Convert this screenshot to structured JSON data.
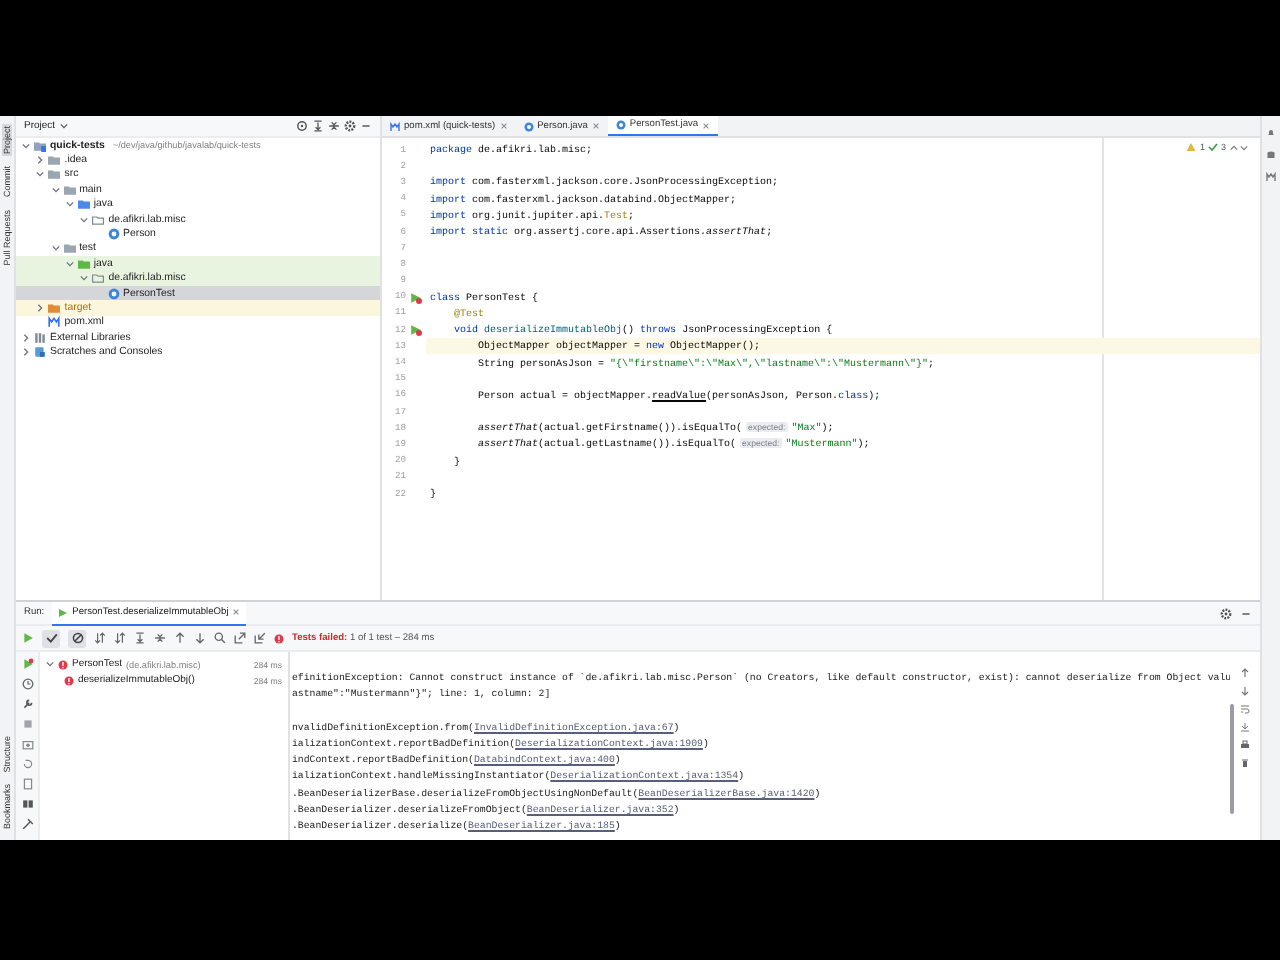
{
  "side_tabs_top": [
    {
      "label": "Project",
      "selected": true
    },
    {
      "label": "Commit",
      "selected": false
    },
    {
      "label": "Pull Requests",
      "selected": false
    }
  ],
  "side_tabs_bottom": [
    {
      "label": "Structure",
      "selected": false
    },
    {
      "label": "Bookmarks",
      "selected": false
    }
  ],
  "project": {
    "title": "Project",
    "tree": [
      {
        "label": "quick-tests",
        "detail": "~/dev/java/github/javalab/quick-tests",
        "kind": "module",
        "expanded": true,
        "selected": false,
        "children": [
          {
            "label": ".idea",
            "kind": "folder",
            "expanded": false,
            "selected": false
          },
          {
            "label": "src",
            "kind": "folder",
            "expanded": true,
            "selected": false,
            "children": [
              {
                "label": "main",
                "kind": "folder",
                "expanded": true,
                "selected": false,
                "children": [
                  {
                    "label": "java",
                    "kind": "source",
                    "expanded": true,
                    "selected": false,
                    "children": [
                      {
                        "label": "de.afikri.lab.misc",
                        "kind": "package",
                        "expanded": true,
                        "selected": false,
                        "children": [
                          {
                            "label": "Person",
                            "kind": "class",
                            "selected": false
                          }
                        ]
                      }
                    ]
                  }
                ]
              },
              {
                "label": "test",
                "kind": "folder",
                "expanded": true,
                "selected": false,
                "children": [
                  {
                    "label": "java",
                    "kind": "test",
                    "color": "#e8f4df",
                    "expanded": true,
                    "selected": false,
                    "children": [
                      {
                        "label": "de.afikri.lab.misc",
                        "kind": "package",
                        "color": "#e8f4df",
                        "expanded": true,
                        "selected": false,
                        "children": [
                          {
                            "label": "PersonTest",
                            "kind": "class",
                            "selected": true
                          }
                        ]
                      }
                    ]
                  }
                ]
              }
            ]
          },
          {
            "label": "target",
            "kind": "excluded",
            "color": "#fbf6dc",
            "expanded": false,
            "selected": false
          },
          {
            "label": "pom.xml",
            "kind": "xml",
            "selected": false
          }
        ]
      },
      {
        "label": "External Libraries",
        "kind": "library",
        "expanded": false,
        "selected": false
      },
      {
        "label": "Scratches and Consoles",
        "kind": "scratch",
        "expanded": false,
        "selected": false
      }
    ]
  },
  "editor": {
    "tabs": [
      {
        "label": "pom.xml (quick-tests)",
        "kind": "xml",
        "selected": false
      },
      {
        "label": "Person.java",
        "kind": "class",
        "selected": false
      },
      {
        "label": "PersonTest.java",
        "kind": "class",
        "selected": true
      }
    ],
    "warnings": "1",
    "checks": "3",
    "lines": [
      {
        "number": "1",
        "current": false,
        "code": [
          {
            "kind": "kw",
            "t": "package"
          },
          {
            "kind": "p",
            "t": " de.afikri.lab.misc;"
          }
        ]
      },
      {
        "number": "2",
        "current": false
      },
      {
        "number": "3",
        "current": false,
        "code": [
          {
            "kind": "kw",
            "t": "import"
          },
          {
            "kind": "p",
            "t": " com.fasterxml.jackson.core.JsonProcessingException;"
          }
        ]
      },
      {
        "number": "4",
        "current": false,
        "code": [
          {
            "kind": "kw",
            "t": "import"
          },
          {
            "kind": "p",
            "t": " com.fasterxml.jackson.databind.ObjectMapper;"
          }
        ]
      },
      {
        "number": "5",
        "current": false,
        "code": [
          {
            "kind": "kw",
            "t": "import"
          },
          {
            "kind": "p",
            "t": " org.junit.jupiter.api."
          },
          {
            "kind": "ann",
            "t": "Test"
          },
          {
            "kind": "p",
            "t": ";"
          }
        ]
      },
      {
        "number": "6",
        "current": false,
        "code": [
          {
            "kind": "kw",
            "t": "import static"
          },
          {
            "kind": "p",
            "t": " org.assertj.core.api.Assertions."
          },
          {
            "kind": "st",
            "t": "assertThat"
          },
          {
            "kind": "p",
            "t": ";"
          }
        ]
      },
      {
        "number": "7",
        "current": false
      },
      {
        "number": "8",
        "current": false
      },
      {
        "number": "9",
        "current": false
      },
      {
        "number": "10",
        "current": false,
        "runnable": true,
        "code": [
          {
            "kind": "kw",
            "t": "class"
          },
          {
            "kind": "p",
            "t": " PersonTest {"
          }
        ]
      },
      {
        "number": "11",
        "current": false,
        "code": [
          {
            "kind": "ann",
            "t": "    @Test"
          }
        ]
      },
      {
        "number": "12",
        "current": false,
        "runnable": true,
        "code": [
          {
            "kind": "kw",
            "t": "    void"
          },
          {
            "kind": "fn",
            "t": " deserializeImmutableObj"
          },
          {
            "kind": "p",
            "t": "() "
          },
          {
            "kind": "kw",
            "t": "throws"
          },
          {
            "kind": "p",
            "t": " JsonProcessingException {"
          }
        ]
      },
      {
        "number": "13",
        "current": true,
        "code": [
          {
            "kind": "p",
            "t": "        ObjectMapper objectMapper = "
          },
          {
            "kind": "kw",
            "t": "new"
          },
          {
            "kind": "p",
            "t": " ObjectMapper();"
          }
        ]
      },
      {
        "number": "14",
        "current": false,
        "code": [
          {
            "kind": "p",
            "t": "        String personAsJson = "
          },
          {
            "kind": "str",
            "t": "\"{\\\"firstname\\\":\\\"Max\\\",\\\"lastname\\\":\\\"Mustermann\\\"}\""
          },
          {
            "kind": "p",
            "t": ";"
          }
        ]
      },
      {
        "number": "15",
        "current": false
      },
      {
        "number": "16",
        "current": false,
        "code": [
          {
            "kind": "p",
            "t": "        Person actual = objectMapper."
          },
          {
            "kind": "ul",
            "t": "readValue"
          },
          {
            "kind": "p",
            "t": "(personAsJson, Person."
          },
          {
            "kind": "kw",
            "t": "class"
          },
          {
            "kind": "p",
            "t": ");"
          }
        ]
      },
      {
        "number": "17",
        "current": false
      },
      {
        "number": "18",
        "current": false,
        "code": [
          {
            "kind": "st",
            "t": "        assertThat"
          },
          {
            "kind": "p",
            "t": "(actual.getFirstname()).isEqualTo("
          },
          {
            "kind": "hint",
            "t": "expected:"
          },
          {
            "kind": "str",
            "t": "\"Max\""
          },
          {
            "kind": "p",
            "t": ");"
          }
        ]
      },
      {
        "number": "19",
        "current": false,
        "code": [
          {
            "kind": "st",
            "t": "        assertThat"
          },
          {
            "kind": "p",
            "t": "(actual.getLastname()).isEqualTo("
          },
          {
            "kind": "hint",
            "t": "expected:"
          },
          {
            "kind": "str",
            "t": "\"Mustermann\""
          },
          {
            "kind": "p",
            "t": ");"
          }
        ]
      },
      {
        "number": "20",
        "current": false,
        "code": [
          {
            "kind": "p",
            "t": "    }"
          }
        ]
      },
      {
        "number": "21",
        "current": false
      },
      {
        "number": "22",
        "current": false,
        "code": [
          {
            "kind": "p",
            "t": "}"
          }
        ]
      }
    ]
  },
  "run": {
    "label": "Run:",
    "tab": "PersonTest.deserializeImmutableObj",
    "status": "**Tests failed:** 1 of 1 test – 284 ms",
    "tests": [
      {
        "label": "PersonTest",
        "detail": "(de.afikri.lab.misc)",
        "time": "284 ms",
        "kind": "failed",
        "selected": false,
        "children": [
          {
            "label": "deserializeImmutableObj()",
            "time": "284 ms",
            "kind": "failed",
            "selected": false
          }
        ]
      }
    ],
    "console": [
      {
        "kind": "message",
        "text": "efinitionException: Cannot construct instance of `de.afikri.lab.misc.Person` (no Creators, like default constructor, exist): cannot deserialize from Object valu"
      },
      {
        "kind": "message",
        "text": "astname\":\"Mustermann\"}\"; line: 1, column: 2]"
      },
      {
        "kind": "blank"
      },
      {
        "kind": "frame",
        "text": "nvalidDefinitionException.from(",
        "link": "InvalidDefinitionException.java:67",
        "end": ")"
      },
      {
        "kind": "frame",
        "text": "ializationContext.reportBadDefinition(",
        "link": "DeserializationContext.java:1909",
        "end": ")"
      },
      {
        "kind": "frame",
        "text": "indContext.reportBadDefinition(",
        "link": "DatabindContext.java:400",
        "end": ")"
      },
      {
        "kind": "frame",
        "text": "ializationContext.handleMissingInstantiator(",
        "link": "DeserializationContext.java:1354",
        "end": ")"
      },
      {
        "kind": "frame",
        "text": ".BeanDeserializerBase.deserializeFromObjectUsingNonDefault(",
        "link": "BeanDeserializerBase.java:1420",
        "end": ")"
      },
      {
        "kind": "frame",
        "text": ".BeanDeserializer.deserializeFromObject(",
        "link": "BeanDeserializer.java:352",
        "end": ")"
      },
      {
        "kind": "frame",
        "text": ".BeanDeserializer.deserialize(",
        "link": "BeanDeserializer.java:185",
        "end": ")"
      }
    ]
  }
}
